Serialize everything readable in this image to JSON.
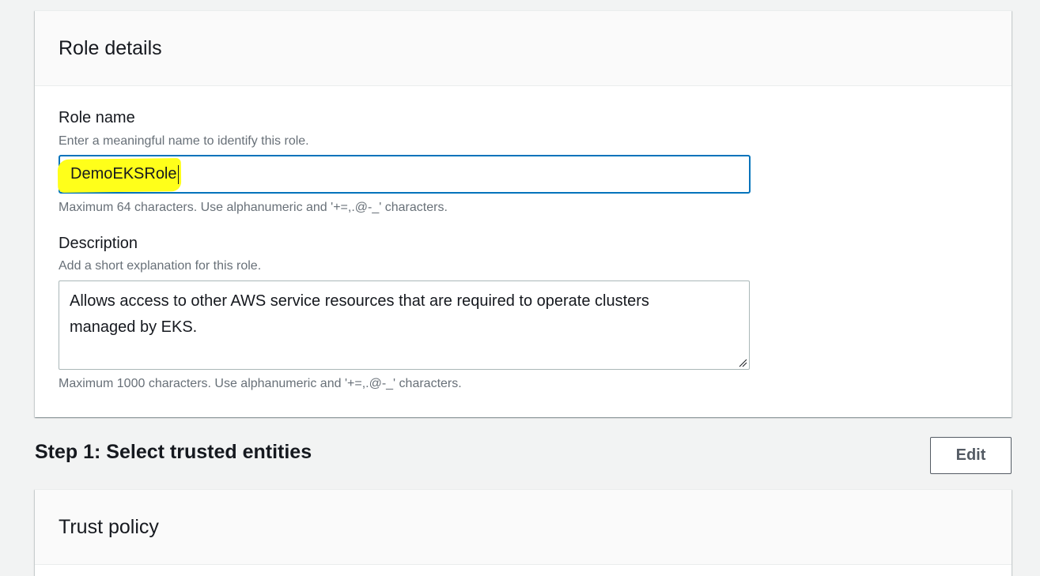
{
  "role_details": {
    "title": "Role details",
    "role_name": {
      "label": "Role name",
      "description": "Enter a meaningful name to identify this role.",
      "value": "DemoEKSRole",
      "constraint": "Maximum 64 characters. Use alphanumeric and '+=,.@-_' characters."
    },
    "description": {
      "label": "Description",
      "description": "Add a short explanation for this role.",
      "value": "Allows access to other AWS service resources that are required to operate clusters managed by EKS.",
      "constraint": "Maximum 1000 characters. Use alphanumeric and '+=,.@-_' characters."
    }
  },
  "step1": {
    "title": "Step 1: Select trusted entities",
    "edit_label": "Edit"
  },
  "trust_policy": {
    "title": "Trust policy"
  },
  "colors": {
    "focus_border": "#0073bb",
    "highlight": "#ffff1a",
    "background": "#f2f3f3"
  }
}
